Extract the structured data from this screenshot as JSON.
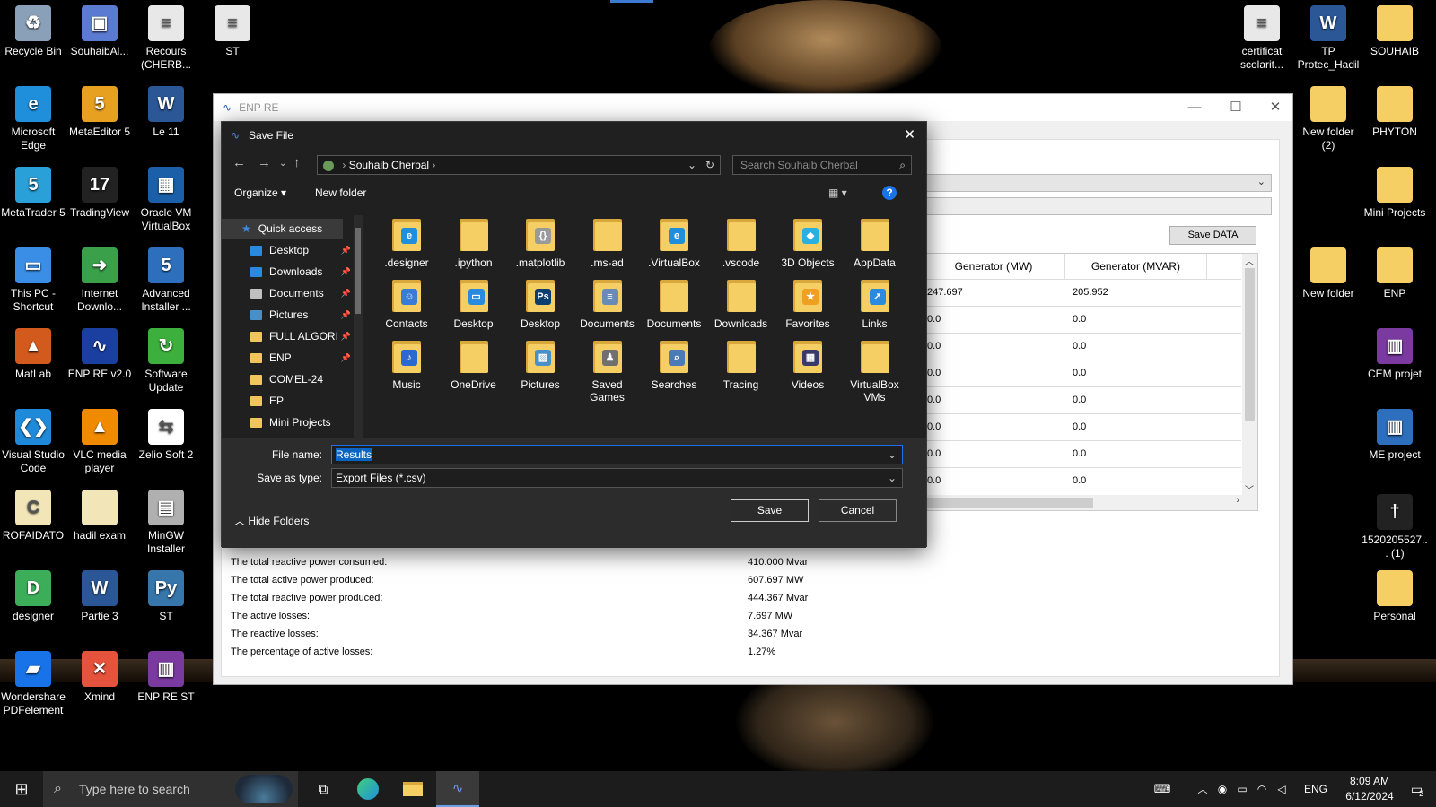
{
  "desktop_left": [
    {
      "label": "Recycle Bin",
      "icon": "recycle-bin-icon",
      "color": "#8aa0b8",
      "glyph": "♻"
    },
    {
      "label": "SouhaibAl...",
      "icon": "shortcut-icon",
      "color": "#5a7bd1",
      "glyph": "▣"
    },
    {
      "label": "Recours (CHERB...",
      "icon": "document-icon",
      "color": "#e8e8e8",
      "glyph": "≡"
    },
    {
      "label": "ST",
      "icon": "text-file-icon",
      "color": "#e8e8e8",
      "glyph": "≡"
    },
    {
      "label": "Microsoft Edge",
      "icon": "edge-icon",
      "color": "#1f8fdb",
      "glyph": "e"
    },
    {
      "label": "MetaEditor 5",
      "icon": "metaeditor-icon",
      "color": "#e8a020",
      "glyph": "5"
    },
    {
      "label": "Le 11",
      "icon": "word-icon",
      "color": "#2b5797",
      "glyph": "W"
    },
    {
      "label": "MetaTrader 5",
      "icon": "metatrader-icon",
      "color": "#2aa0d8",
      "glyph": "5"
    },
    {
      "label": "TradingView",
      "icon": "tradingview-icon",
      "color": "#222222",
      "glyph": "17"
    },
    {
      "label": "Oracle VM VirtualBox",
      "icon": "virtualbox-icon",
      "color": "#1b5fa8",
      "glyph": "▦"
    },
    {
      "label": "This PC - Shortcut",
      "icon": "this-pc-icon",
      "color": "#3a8ee6",
      "glyph": "▭"
    },
    {
      "label": "Internet Downlo...",
      "icon": "idm-icon",
      "color": "#3aa04a",
      "glyph": "➜"
    },
    {
      "label": "Advanced Installer ...",
      "icon": "advanced-installer-icon",
      "color": "#2d6fbd",
      "glyph": "5"
    },
    {
      "label": "MatLab",
      "icon": "matlab-icon",
      "color": "#d35a1d",
      "glyph": "▲"
    },
    {
      "label": "ENP RE v2.0",
      "icon": "enp-icon",
      "color": "#1b3fa0",
      "glyph": "∿"
    },
    {
      "label": "Software Update",
      "icon": "software-update-icon",
      "color": "#3caf3c",
      "glyph": "↻"
    },
    {
      "label": "Visual Studio Code",
      "icon": "vscode-icon",
      "color": "#1f8ad9",
      "glyph": "❮❯"
    },
    {
      "label": "VLC media player",
      "icon": "vlc-icon",
      "color": "#f08a00",
      "glyph": "▲"
    },
    {
      "label": "Zelio Soft 2",
      "icon": "zelio-icon",
      "color": "#ffffff",
      "glyph": "⇆"
    },
    {
      "label": "ROFAIDATO",
      "icon": "file-icon",
      "color": "#f2e6b8",
      "glyph": "C"
    },
    {
      "label": "hadil exam",
      "icon": "file-icon",
      "color": "#f2e6b8",
      "glyph": ""
    },
    {
      "label": "MinGW Installer",
      "icon": "mingw-icon",
      "color": "#b0b0b0",
      "glyph": "▤"
    },
    {
      "label": "designer",
      "icon": "designer-icon",
      "color": "#3cae5a",
      "glyph": "D"
    },
    {
      "label": "Partie 3",
      "icon": "word-icon",
      "color": "#2b5797",
      "glyph": "W"
    },
    {
      "label": "ST",
      "icon": "python-icon",
      "color": "#3776ab",
      "glyph": "Py"
    },
    {
      "label": "Wondershare PDFelement",
      "icon": "pdfelement-icon",
      "color": "#1873e8",
      "glyph": "▰"
    },
    {
      "label": "Xmind",
      "icon": "xmind-icon",
      "color": "#e5533c",
      "glyph": "✕"
    },
    {
      "label": "ENP RE ST",
      "icon": "winrar-icon",
      "color": "#7a3aa0",
      "glyph": "▥"
    }
  ],
  "desktop_right": [
    {
      "label": "certificat scolarit...",
      "icon": "document-icon",
      "color": "#e8e8e8",
      "glyph": "≡"
    },
    {
      "label": "TP Protec_Hadil",
      "icon": "word-icon",
      "color": "#2b5797",
      "glyph": "W"
    },
    {
      "label": "SOUHAIB",
      "icon": "folder-icon",
      "color": "#f5cf63",
      "glyph": ""
    },
    {
      "label": "New folder (2)",
      "icon": "folder-icon",
      "color": "#f5cf63",
      "glyph": ""
    },
    {
      "label": "PHYTON",
      "icon": "folder-icon",
      "color": "#f5cf63",
      "glyph": ""
    },
    {
      "label": "Mini Projects",
      "icon": "folder-icon",
      "color": "#f5cf63",
      "glyph": ""
    },
    {
      "label": "New folder",
      "icon": "folder-icon",
      "color": "#f5cf63",
      "glyph": ""
    },
    {
      "label": "ENP",
      "icon": "folder-icon",
      "color": "#f5cf63",
      "glyph": ""
    },
    {
      "label": "CEM projet",
      "icon": "winrar-icon",
      "color": "#7a3aa0",
      "glyph": "▥"
    },
    {
      "label": "ME project",
      "icon": "winrar-icon",
      "color": "#2d6fbd",
      "glyph": "▥"
    },
    {
      "label": "1520205527... (1)",
      "icon": "image-icon",
      "color": "#222222",
      "glyph": "†"
    },
    {
      "label": "Personal",
      "icon": "folder-icon",
      "color": "#f5cf63",
      "glyph": ""
    }
  ],
  "app": {
    "title": "ENP RE",
    "save_data": "Save DATA",
    "columns": [
      ")",
      "Generator (MW)",
      "Generator (MVAR)"
    ],
    "rows": [
      [
        "247.697",
        "205.952"
      ],
      [
        "0.0",
        "0.0"
      ],
      [
        "0.0",
        "0.0"
      ],
      [
        "0.0",
        "0.0"
      ],
      [
        "0.0",
        "0.0"
      ],
      [
        "0.0",
        "0.0"
      ],
      [
        "0.0",
        "0.0"
      ],
      [
        "0.0",
        "0.0"
      ]
    ],
    "summary": [
      [
        "The total reactive power consumed:",
        "410.000 Mvar"
      ],
      [
        "The total active power produced:",
        "607.697 MW"
      ],
      [
        "The total reactive power produced:",
        "444.367 Mvar"
      ],
      [
        "The active losses:",
        "7.697 MW"
      ],
      [
        "The reactive losses:",
        "34.367 Mvar"
      ],
      [
        "The percentage of active losses:",
        "1.27%"
      ]
    ]
  },
  "dialog": {
    "title": "Save File",
    "address": "Souhaib Cherbal",
    "search_placeholder": "Search Souhaib Cherbal",
    "organize": "Organize",
    "new_folder": "New folder",
    "quick_access": "Quick access",
    "tree": [
      {
        "label": "Desktop",
        "pinned": true
      },
      {
        "label": "Downloads",
        "pinned": true
      },
      {
        "label": "Documents",
        "pinned": true
      },
      {
        "label": "Pictures",
        "pinned": true
      },
      {
        "label": "FULL ALGORI",
        "pinned": true
      },
      {
        "label": "ENP",
        "pinned": true
      },
      {
        "label": "COMEL-24",
        "pinned": false
      },
      {
        "label": "EP",
        "pinned": false
      },
      {
        "label": "Mini Projects",
        "pinned": false
      }
    ],
    "items": [
      {
        "label": ".designer",
        "icon": "edge-folder-icon",
        "badge": "e",
        "badge_color": "#1f8fdb"
      },
      {
        "label": ".ipython",
        "icon": "folder-icon",
        "badge": "",
        "badge_color": ""
      },
      {
        "label": ".matplotlib",
        "icon": "folder-icon",
        "badge": "{}",
        "badge_color": "#9a9a9a"
      },
      {
        "label": ".ms-ad",
        "icon": "folder-icon",
        "badge": "",
        "badge_color": ""
      },
      {
        "label": ".VirtualBox",
        "icon": "virtualbox-folder-icon",
        "badge": "e",
        "badge_color": "#1f8fdb"
      },
      {
        "label": ".vscode",
        "icon": "folder-icon",
        "badge": "",
        "badge_color": ""
      },
      {
        "label": "3D Objects",
        "icon": "3d-objects-icon",
        "badge": "◆",
        "badge_color": "#2ab0e0"
      },
      {
        "label": "AppData",
        "icon": "folder-icon",
        "badge": "",
        "badge_color": ""
      },
      {
        "label": "Contacts",
        "icon": "contacts-icon",
        "badge": "☺",
        "badge_color": "#3a7bd5"
      },
      {
        "label": "Desktop",
        "icon": "desktop-folder-icon",
        "badge": "▭",
        "badge_color": "#2a8ae0"
      },
      {
        "label": "Desktop",
        "icon": "photoshop-folder-icon",
        "badge": "Ps",
        "badge_color": "#0b3d6e"
      },
      {
        "label": "Documents",
        "icon": "documents-folder-icon",
        "badge": "≡",
        "badge_color": "#6a8ab8"
      },
      {
        "label": "Documents",
        "icon": "folder-icon",
        "badge": "",
        "badge_color": ""
      },
      {
        "label": "Downloads",
        "icon": "folder-icon",
        "badge": "",
        "badge_color": ""
      },
      {
        "label": "Favorites",
        "icon": "favorites-icon",
        "badge": "★",
        "badge_color": "#f0a020"
      },
      {
        "label": "Links",
        "icon": "links-icon",
        "badge": "↗",
        "badge_color": "#2a8ae0"
      },
      {
        "label": "Music",
        "icon": "music-folder-icon",
        "badge": "♪",
        "badge_color": "#2a6ad0"
      },
      {
        "label": "OneDrive",
        "icon": "folder-icon",
        "badge": "",
        "badge_color": ""
      },
      {
        "label": "Pictures",
        "icon": "pictures-folder-icon",
        "badge": "▨",
        "badge_color": "#4a90c8"
      },
      {
        "label": "Saved Games",
        "icon": "saved-games-icon",
        "badge": "♟",
        "badge_color": "#707070"
      },
      {
        "label": "Searches",
        "icon": "searches-icon",
        "badge": "⌕",
        "badge_color": "#4a7ab8"
      },
      {
        "label": "Tracing",
        "icon": "folder-icon",
        "badge": "",
        "badge_color": ""
      },
      {
        "label": "Videos",
        "icon": "videos-folder-icon",
        "badge": "▦",
        "badge_color": "#3a3a6a"
      },
      {
        "label": "VirtualBox VMs",
        "icon": "folder-icon",
        "badge": "",
        "badge_color": ""
      }
    ],
    "file_name_label": "File name:",
    "file_name": "Results",
    "save_type_label": "Save as type:",
    "save_type": "Export Files (*.csv)",
    "hide_folders": "Hide Folders",
    "save": "Save",
    "cancel": "Cancel"
  },
  "taskbar": {
    "search_placeholder": "Type here to search",
    "lang": "ENG",
    "time": "8:09 AM",
    "date": "6/12/2024",
    "notifications": "2"
  }
}
